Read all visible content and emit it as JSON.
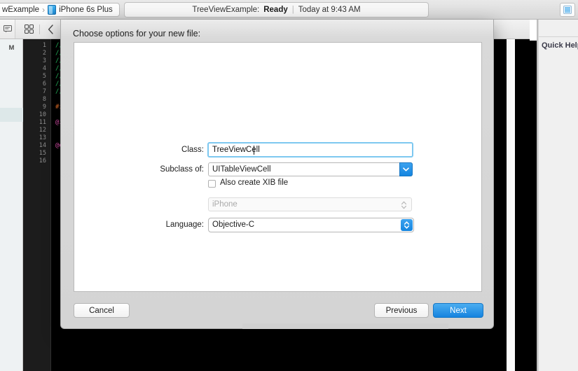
{
  "toolbar": {
    "scheme": {
      "project": "wExample",
      "separator": "›",
      "device": "iPhone 6s Plus",
      "device_icon": "device-iphone-icon"
    },
    "status": {
      "scheme_name": "TreeViewExample:",
      "state": "Ready",
      "divider": "|",
      "timestamp": "Today at 9:43 AM"
    },
    "utilities_button_icon": "utilities-panel-icon"
  },
  "subbar": {
    "related_files_icon": "related-files-icon",
    "grid_icon": "grid-view-icon",
    "back_icon": "chevron-left-icon",
    "forward_icon": "chevron-right-icon"
  },
  "navigator": {
    "modified_badge": "M"
  },
  "editor": {
    "line_numbers": [
      "1",
      "2",
      "3",
      "4",
      "5",
      "6",
      "7",
      "8",
      "9",
      "10",
      "11",
      "12",
      "13",
      "14",
      "15",
      "16"
    ],
    "lines": [
      {
        "n": 1,
        "text": "//",
        "kind": "comment"
      },
      {
        "n": 2,
        "text": "//  Vi",
        "kind": "comment"
      },
      {
        "n": 3,
        "text": "//  Tr",
        "kind": "comment"
      },
      {
        "n": 4,
        "text": "//",
        "kind": "comment"
      },
      {
        "n": 5,
        "text": "//  Cr",
        "kind": "comment"
      },
      {
        "n": 6,
        "text": "//  Co",
        "kind": "comment"
      },
      {
        "n": 7,
        "text": "//",
        "kind": "comment"
      },
      {
        "n": 9,
        "text": "#impor",
        "kind": "preprocessor"
      },
      {
        "n": 11,
        "text": "@inter",
        "kind": "keyword"
      },
      {
        "n": 14,
        "text": "@end",
        "kind": "keyword"
      }
    ]
  },
  "quick_help": {
    "title": "Quick Help"
  },
  "sheet": {
    "title": "Choose options for your new file:",
    "fields": {
      "class": {
        "label": "Class:",
        "value": "TreeViewCell",
        "placeholder": ""
      },
      "subclass": {
        "label": "Subclass of:",
        "value": "UITableViewCell",
        "arrow_icon": "chevron-down-icon"
      },
      "xib": {
        "label": "Also create XIB file",
        "checked": false
      },
      "device": {
        "value": "iPhone",
        "enabled": false,
        "arrow_icon": "stepper-updown-icon"
      },
      "language": {
        "label": "Language:",
        "value": "Objective-C",
        "arrow_icon": "stepper-updown-icon"
      }
    },
    "buttons": {
      "cancel": "Cancel",
      "previous": "Previous",
      "next": "Next"
    }
  },
  "colors": {
    "accent_blue": "#1583df",
    "focus_ring": "#7dc8f0",
    "comment_green": "#29c463",
    "preprocessor_orange": "#f4762b",
    "keyword_pink": "#e754b4",
    "sheet_bg": "#d4d4d4"
  }
}
